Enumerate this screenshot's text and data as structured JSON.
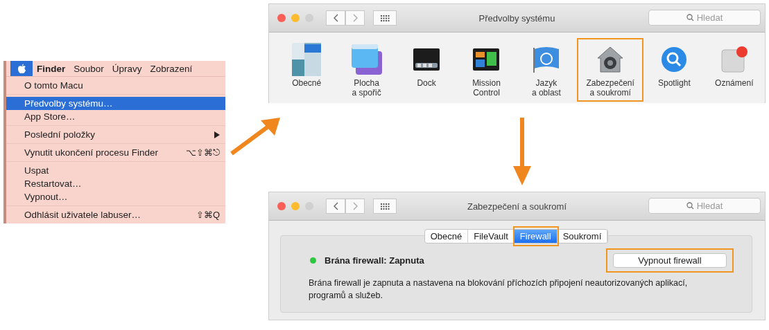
{
  "menu": {
    "apple_selected": true,
    "menu_bar": [
      {
        "label": "Finder",
        "kind": "app"
      },
      {
        "label": "Soubor",
        "kind": "menu"
      },
      {
        "label": "Úpravy",
        "kind": "menu"
      },
      {
        "label": "Zobrazení",
        "kind": "menu"
      }
    ],
    "groups": [
      [
        {
          "label": "O tomto Macu",
          "selected": false
        }
      ],
      [
        {
          "label": "Předvolby systému…",
          "selected": true
        },
        {
          "label": "App Store…",
          "selected": false
        }
      ],
      [
        {
          "label": "Poslední položky",
          "selected": false,
          "submenu": true
        }
      ],
      [
        {
          "label": "Vynutit ukončení procesu Finder",
          "selected": false,
          "shortcut": "⌥⇧⌘⎋"
        }
      ],
      [
        {
          "label": "Uspat",
          "selected": false
        },
        {
          "label": "Restartovat…",
          "selected": false
        },
        {
          "label": "Vypnout…",
          "selected": false
        }
      ],
      [
        {
          "label": "Odhlásit uživatele labuser…",
          "selected": false,
          "shortcut": "⇧⌘Q"
        }
      ]
    ]
  },
  "preferences_window": {
    "title": "Předvolby systému",
    "search": {
      "placeholder": "Hledat"
    },
    "panes": [
      {
        "kind": "general",
        "label": "Obecné",
        "highlighted": false
      },
      {
        "kind": "desktop",
        "label": "Plocha\na spořič",
        "highlighted": false
      },
      {
        "kind": "dock",
        "label": "Dock",
        "highlighted": false
      },
      {
        "kind": "mission",
        "label": "Mission\nControl",
        "highlighted": false
      },
      {
        "kind": "language",
        "label": "Jazyk\na oblast",
        "highlighted": false
      },
      {
        "kind": "security",
        "label": "Zabezpečení\na soukromí",
        "highlighted": true
      },
      {
        "kind": "spotlight",
        "label": "Spotlight",
        "highlighted": false
      },
      {
        "kind": "notifications",
        "label": "Oznámení",
        "highlighted": false
      }
    ]
  },
  "security_window": {
    "title": "Zabezpečení a soukromí",
    "search": {
      "placeholder": "Hledat"
    },
    "tabs": [
      {
        "label": "Obecné",
        "selected": false,
        "highlighted": false
      },
      {
        "label": "FileVault",
        "selected": false,
        "highlighted": false
      },
      {
        "label": "Firewall",
        "selected": true,
        "highlighted": true
      },
      {
        "label": "Soukromí",
        "selected": false,
        "highlighted": false
      }
    ],
    "status": {
      "label": "Brána firewall: Zapnuta",
      "color": "#2ec840"
    },
    "button": {
      "label": "Vypnout firewall",
      "highlighted": true
    },
    "description": "Brána firewall je zapnuta a nastavena na blokování příchozích připojení neautorizovaných aplikací, programů a služeb."
  }
}
